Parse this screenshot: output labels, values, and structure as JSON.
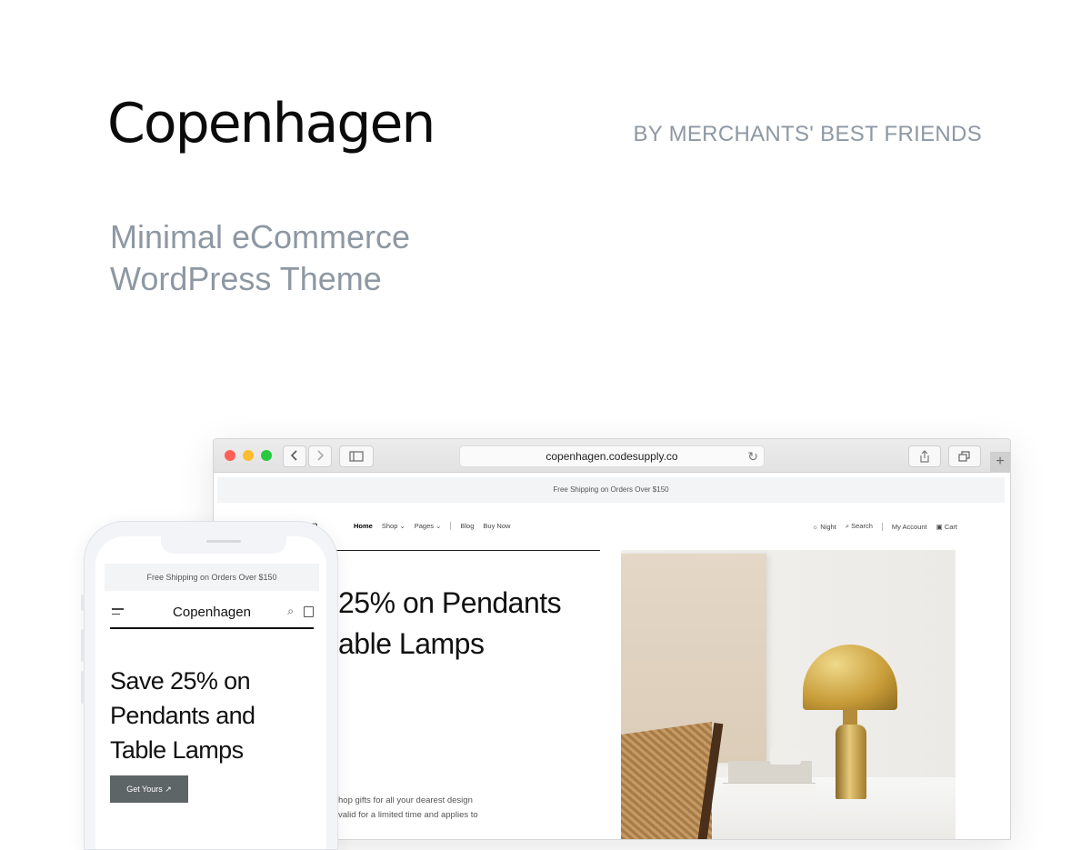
{
  "hero": {
    "title": "Copenhagen",
    "byline": "BY MERCHANTS' BEST FRIENDS",
    "tagline_line1": "Minimal eCommerce",
    "tagline_line2": "WordPress Theme"
  },
  "browser": {
    "url": "copenhagen.codesupply.co",
    "back_icon": "chevron-left-icon",
    "forward_icon": "chevron-right-icon",
    "sidebar_icon": "sidebar-icon",
    "reload_icon": "reload-icon",
    "share_icon": "share-icon",
    "tabs_icon": "tabs-icon",
    "new_tab_label": "+"
  },
  "desktop_site": {
    "promo": "Free Shipping on Orders Over $150",
    "logo_partial": "n",
    "nav": {
      "home": "Home",
      "shop": "Shop ⌄",
      "pages": "Pages ⌄",
      "blog": "Blog",
      "buy": "Buy Now"
    },
    "nav_right": {
      "night": "☼ Night",
      "search": "⌕ Search",
      "account": "My Account",
      "cart": "▣ Cart"
    },
    "heading_line1": "25% on Pendants",
    "heading_line2": "able Lamps",
    "text_line1": "hop gifts for all your dearest design",
    "text_line2": "valid for a limited time and applies to"
  },
  "mobile_site": {
    "promo": "Free Shipping on Orders Over $150",
    "logo": "Copenhagen",
    "heading_line1": "Save 25% on",
    "heading_line2": "Pendants and",
    "heading_line3": "Table Lamps",
    "button": "Get Yours ↗"
  }
}
